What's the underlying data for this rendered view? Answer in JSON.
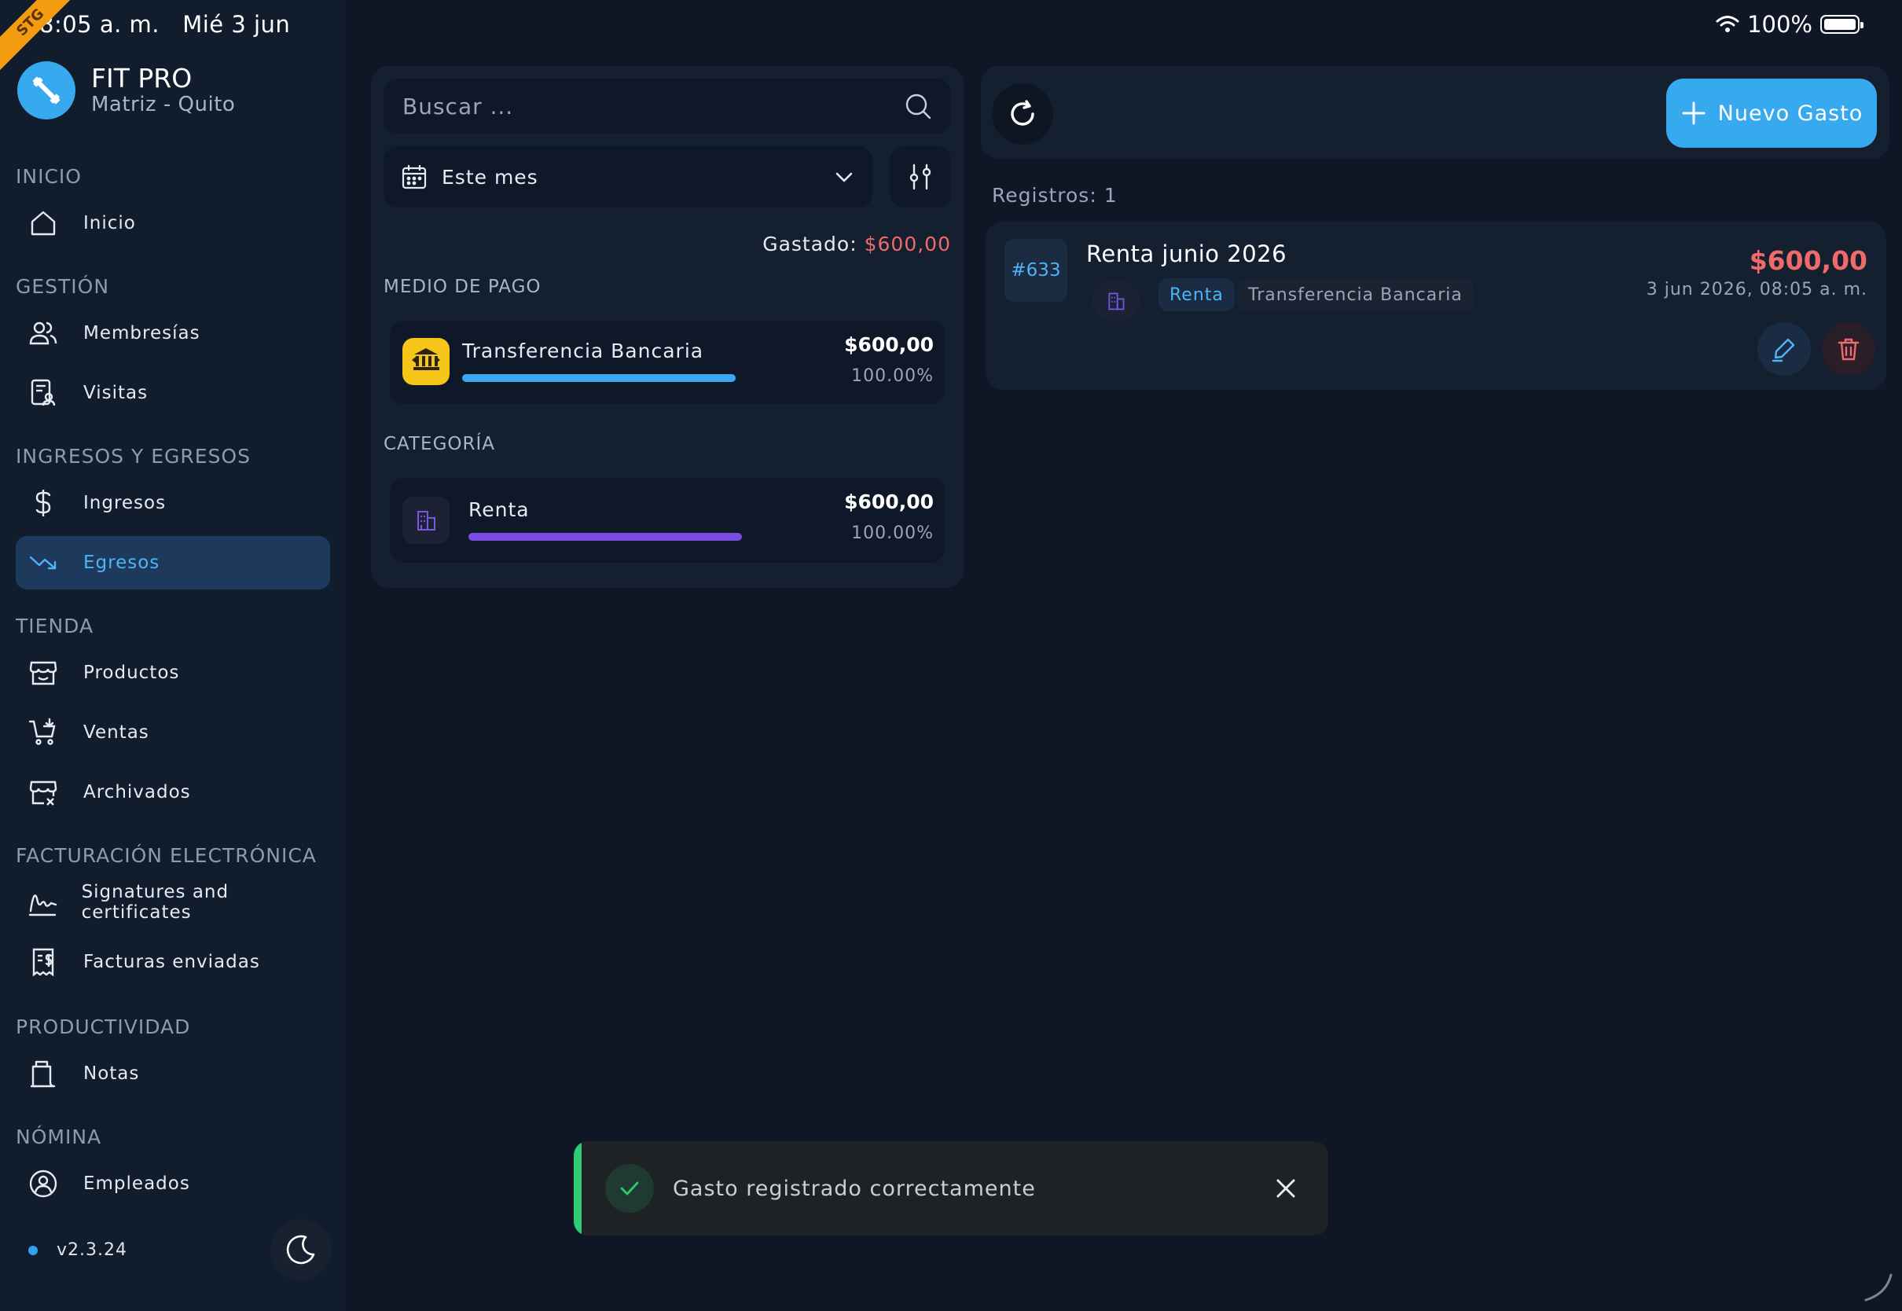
{
  "status_bar": {
    "time": "8:05 a. m.",
    "date": "Mié 3 jun",
    "battery": "100%",
    "ribbon": "STG"
  },
  "brand": {
    "name": "FIT PRO",
    "branch": "Matriz - Quito"
  },
  "sidebar": {
    "sections": [
      {
        "title": "INICIO"
      },
      {
        "title": "GESTIÓN"
      },
      {
        "title": "INGRESOS Y EGRESOS"
      },
      {
        "title": "TIENDA"
      },
      {
        "title": "FACTURACIÓN ELECTRÓNICA"
      },
      {
        "title": "PRODUCTIVIDAD"
      },
      {
        "title": "NÓMINA"
      }
    ],
    "items": [
      {
        "label": "Inicio",
        "icon": "home-icon"
      },
      {
        "label": "Membresías",
        "icon": "users-icon"
      },
      {
        "label": "Visitas",
        "icon": "visitor-badge-icon"
      },
      {
        "label": "Ingresos",
        "icon": "dollar-icon"
      },
      {
        "label": "Egresos",
        "icon": "trend-down-icon",
        "active": true
      },
      {
        "label": "Productos",
        "icon": "store-icon"
      },
      {
        "label": "Ventas",
        "icon": "cart-icon"
      },
      {
        "label": "Archivados",
        "icon": "store-archived-icon"
      },
      {
        "label": "Signatures and certificates",
        "icon": "signature-icon"
      },
      {
        "label": "Facturas enviadas",
        "icon": "receipt-icon"
      },
      {
        "label": "Notas",
        "icon": "notes-icon"
      },
      {
        "label": "Empleados",
        "icon": "user-circle-icon"
      }
    ],
    "version": "v2.3.24"
  },
  "filters": {
    "search_placeholder": "Buscar ...",
    "date_range": "Este mes",
    "spent_label": "Gastado:",
    "spent_amount": "$600,00",
    "payment_section": "MEDIO DE PAGO",
    "category_section": "CATEGORÍA",
    "payment_methods": [
      {
        "name": "Transferencia Bancaria",
        "amount": "$600,00",
        "percent": "100.00%",
        "share": 1.0
      }
    ],
    "categories": [
      {
        "name": "Renta",
        "amount": "$600,00",
        "percent": "100.00%",
        "share": 1.0
      }
    ]
  },
  "toolbar": {
    "new_button": "Nuevo Gasto"
  },
  "records": {
    "count_label": "Registros: 1",
    "items": [
      {
        "id": "#633",
        "title": "Renta junio 2026",
        "category": "Renta",
        "payment": "Transferencia Bancaria",
        "amount": "$600,00",
        "date": "3 jun 2026, 08:05 a. m."
      }
    ]
  },
  "toast": {
    "message": "Gasto registrado correctamente"
  },
  "colors": {
    "accent": "#36a9ef",
    "expense_red": "#f06a6a",
    "payment_bar": "#3aa8f0",
    "category_bar": "#7a4de0",
    "success": "#2ecc71"
  }
}
